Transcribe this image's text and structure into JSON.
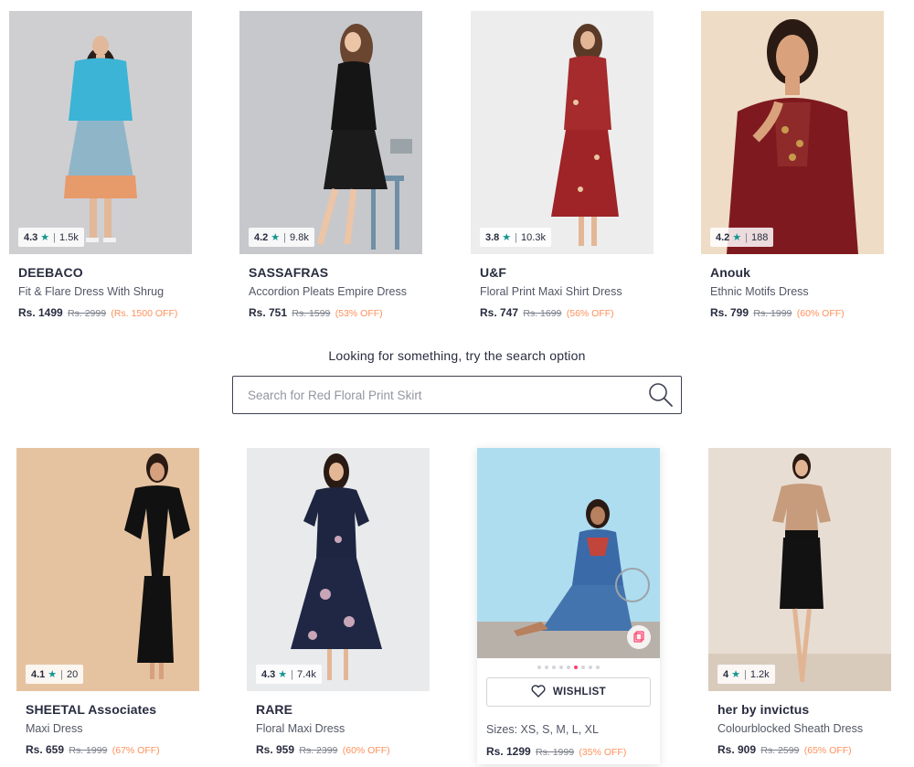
{
  "colors": {
    "accent": "#ff3f6c",
    "star": "#14958f",
    "discount": "#ff905a",
    "text": "#282c3f"
  },
  "icons": {
    "rating": "star-icon",
    "search": "search-icon",
    "wishlist": "heart-icon",
    "similar": "view-similar-icon"
  },
  "row1": [
    {
      "brand": "DEEBACO",
      "name": "Fit & Flare Dress With Shrug",
      "price": "Rs. 1499",
      "mrp": "Rs. 2999",
      "off": "(Rs. 1500 OFF)",
      "rating": "4.3",
      "count": "1.5k"
    },
    {
      "brand": "SASSAFRAS",
      "name": "Accordion Pleats Empire Dress",
      "price": "Rs. 751",
      "mrp": "Rs. 1599",
      "off": "(53% OFF)",
      "rating": "4.2",
      "count": "9.8k"
    },
    {
      "brand": "U&F",
      "name": "Floral Print Maxi Shirt Dress",
      "price": "Rs. 747",
      "mrp": "Rs. 1699",
      "off": "(56% OFF)",
      "rating": "3.8",
      "count": "10.3k"
    },
    {
      "brand": "Anouk",
      "name": "Ethnic Motifs Dress",
      "price": "Rs. 799",
      "mrp": "Rs. 1999",
      "off": "(60% OFF)",
      "rating": "4.2",
      "count": "188"
    }
  ],
  "search": {
    "title": "Looking for something, try the search option",
    "placeholder": "Search for Red Floral Print Skirt"
  },
  "row2": [
    {
      "brand": "SHEETAL Associates",
      "name": "Maxi Dress",
      "price": "Rs. 659",
      "mrp": "Rs. 1999",
      "off": "(67% OFF)",
      "rating": "4.1",
      "count": "20"
    },
    {
      "brand": "RARE",
      "name": "Floral Maxi Dress",
      "price": "Rs. 959",
      "mrp": "Rs. 2399",
      "off": "(60% OFF)",
      "rating": "4.3",
      "count": "7.4k"
    },
    {
      "wishlist_label": "WISHLIST",
      "sizes": "Sizes: XS, S, M, L, XL",
      "price": "Rs. 1299",
      "mrp": "Rs. 1999",
      "off": "(35% OFF)"
    },
    {
      "brand": "her by invictus",
      "name": "Colourblocked Sheath Dress",
      "price": "Rs. 909",
      "mrp": "Rs. 2599",
      "off": "(65% OFF)",
      "rating": "4",
      "count": "1.2k"
    }
  ]
}
